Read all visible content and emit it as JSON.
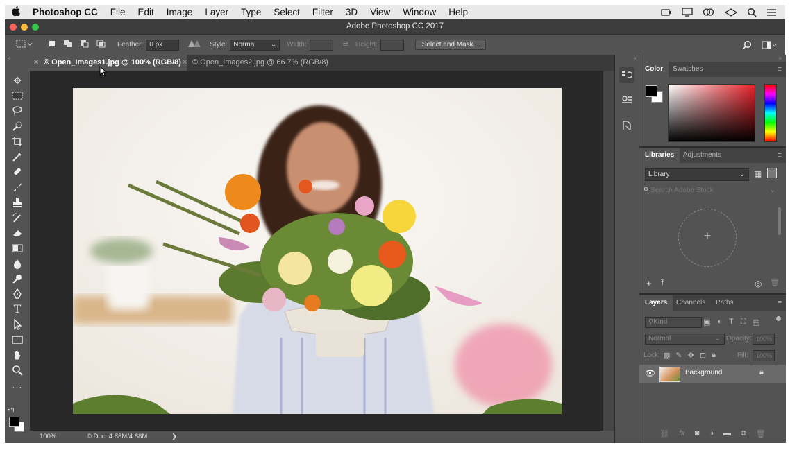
{
  "mac_menu": {
    "apple_icon": "apple-logo-icon",
    "app_name": "Photoshop CC",
    "items": [
      "File",
      "Edit",
      "Image",
      "Layer",
      "Type",
      "Select",
      "Filter",
      "3D",
      "View",
      "Window",
      "Help"
    ],
    "status_icons": [
      "camera-icon",
      "monitor-icon",
      "cc-icon",
      "drive-icon",
      "search-icon",
      "list-icon"
    ]
  },
  "window": {
    "title": "Adobe Photoshop CC 2017",
    "traffic_colors": {
      "close": "#fc605b",
      "minimize": "#fdbc40",
      "zoom": "#34c84a"
    }
  },
  "options_bar": {
    "feather_label": "Feather:",
    "feather_value": "0 px",
    "style_label": "Style:",
    "style_value": "Normal",
    "width_label": "Width:",
    "height_label": "Height:",
    "select_mask_label": "Select and Mask..."
  },
  "doc_tabs": [
    {
      "title": "© Open_Images1.jpg @ 100% (RGB/8)",
      "active": true
    },
    {
      "title": "© Open_Images2.jpg @ 66.7% (RGB/8)",
      "active": false
    }
  ],
  "status": {
    "zoom": "100%",
    "doc": "© Doc: 4.88M/4.88M",
    "arrow": "❯"
  },
  "tools": [
    "move-tool",
    "marquee-tool",
    "lasso-tool",
    "quick-select-tool",
    "crop-tool",
    "eyedropper-tool",
    "healing-brush-tool",
    "brush-tool",
    "clone-stamp-tool",
    "history-brush-tool",
    "eraser-tool",
    "gradient-tool",
    "blur-tool",
    "dodge-tool",
    "pen-tool",
    "type-tool",
    "path-select-tool",
    "rectangle-tool",
    "hand-tool",
    "zoom-tool",
    "more-tools"
  ],
  "color_panel": {
    "tabs": [
      "Color",
      "Swatches"
    ],
    "foreground": "#000000",
    "background": "#ffffff",
    "picker_hue": "#e8212a"
  },
  "libraries_panel": {
    "tabs": [
      "Libraries",
      "Adjustments"
    ],
    "library_select": "Library",
    "search_placeholder": "Search Adobe Stock",
    "add_symbol": "+"
  },
  "layers_panel": {
    "tabs": [
      "Layers",
      "Channels",
      "Paths"
    ],
    "filter_label": "Kind",
    "blend_mode": "Normal",
    "opacity_label": "Opacity:",
    "opacity_value": "100%",
    "lock_label": "Lock:",
    "fill_label": "Fill:",
    "fill_value": "100%",
    "layers": [
      {
        "name": "Background",
        "visible": true,
        "locked": true
      }
    ]
  }
}
